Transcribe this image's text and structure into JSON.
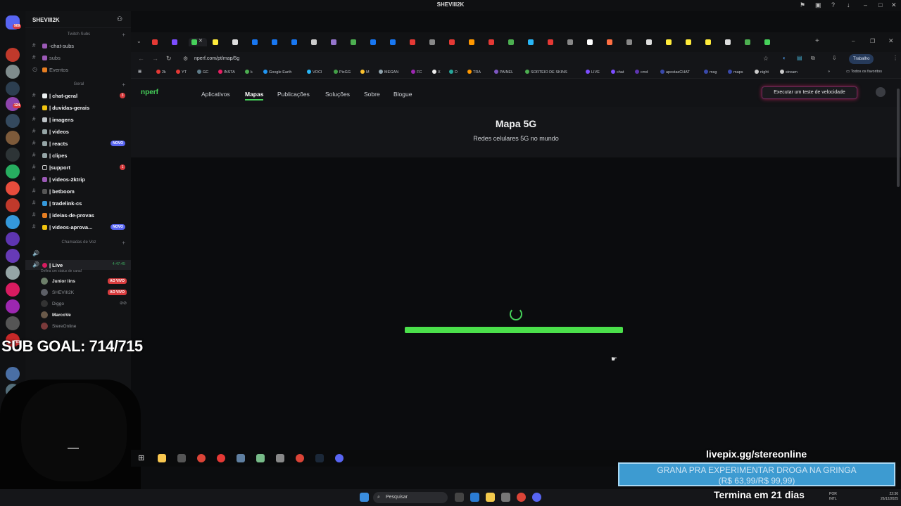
{
  "window": {
    "title": "SHEVIII2K"
  },
  "discord": {
    "server_name": "SHEVIII2K",
    "guild_badges": [
      "909",
      "124",
      "701"
    ],
    "categories": {
      "twitch": "Twitch Subs",
      "geral": "Geral",
      "voice": "Chamadas de Voz"
    },
    "twitch_channels": [
      {
        "label": "-chat-subs",
        "color": "#9b59b6"
      },
      {
        "label": "subs",
        "color": "#9b59b6"
      },
      {
        "label": "Eventos",
        "color": "#e67e22"
      }
    ],
    "channels": [
      {
        "label": "| chat-geral",
        "badge": "3",
        "bold": true
      },
      {
        "label": "| duvidas-gerais",
        "bold": true
      },
      {
        "label": "| imagens",
        "bold": true
      },
      {
        "label": "| videos",
        "bold": true
      },
      {
        "label": "| reacts",
        "badge_new": "NOVO",
        "bold": true
      },
      {
        "label": "| clipes",
        "bold": true
      },
      {
        "label": "|support",
        "badge": "1",
        "bold": true
      },
      {
        "label": "| videos-2ktrip",
        "bold": true
      },
      {
        "label": "| betboom",
        "bold": true
      },
      {
        "label": "| tradelink-cs",
        "bold": true
      },
      {
        "label": "| ideias-de-provas",
        "bold": true
      },
      {
        "label": "| videos-aprova...",
        "badge_new": "NOVO",
        "bold": true
      }
    ],
    "voice_live": {
      "label": "| Live",
      "timer": "4:47:45",
      "status": "Defina um status de canal"
    },
    "voice_users": [
      {
        "name": "Junior lins",
        "live": "AO VIVO"
      },
      {
        "name": "SHEVIII2K",
        "live": "AO VIVO"
      },
      {
        "name": "Diggo",
        "live": ""
      },
      {
        "name": "MarcoVe",
        "live": ""
      },
      {
        "name": "StereOnline",
        "live": ""
      }
    ]
  },
  "browser": {
    "url": "nperf.com/pt/map/5g",
    "profile": "Trabalho",
    "bookmarks": [
      "2k",
      "YT",
      "GC",
      "INSTA",
      "k",
      "Google Earth",
      "VOCI",
      "PixGG",
      "M",
      "MEGAN",
      "FC",
      "X",
      "D",
      "TRA",
      "PAINEL",
      "SORTEIO DE SKINS",
      "LIVE",
      "chat",
      "cmd",
      "apostasCHAT",
      "msg",
      "maps",
      "night",
      "stream"
    ],
    "all_bookmarks": "Todos os favoritos"
  },
  "site": {
    "logo": "nperf",
    "nav": [
      "Aplicativos",
      "Mapas",
      "Publicações",
      "Soluções",
      "Sobre",
      "Blogue"
    ],
    "active_nav": "Mapas",
    "speedtest_button": "Executar um teste de velocidade",
    "title": "Mapa 5G",
    "subtitle": "Redes celulares 5G no mundo",
    "loading_progress": 1.0
  },
  "overlay": {
    "sub_goal": "SUB GOAL: 714/715",
    "livepix": "livepix.gg/stereonline",
    "donation_line1": "GRANA PRA EXPERIMENTAR DROGA NA GRINGA",
    "donation_line2": "(R$ 63,99/R$ 99,99)",
    "termina": "Termina em 21 dias"
  },
  "taskbar": {
    "search": "Pesquisar",
    "lang": "POR",
    "lang2": "INTL",
    "time": "22:36",
    "date": "26/12/2025"
  }
}
